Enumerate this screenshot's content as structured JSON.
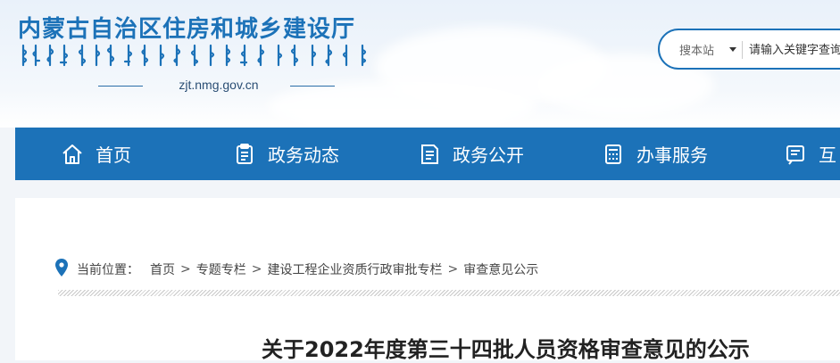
{
  "header": {
    "title": "内蒙古自治区住房和城乡建设厅",
    "domain": "zjt.nmg.gov.cn"
  },
  "search": {
    "scope": "搜本站",
    "placeholder": "请输入关键字查询"
  },
  "nav": {
    "items": [
      {
        "label": "首页",
        "icon": "home-icon"
      },
      {
        "label": "政务动态",
        "icon": "clipboard-icon"
      },
      {
        "label": "政务公开",
        "icon": "document-icon"
      },
      {
        "label": "办事服务",
        "icon": "calculator-icon"
      },
      {
        "label": "互",
        "icon": "interaction-icon"
      }
    ]
  },
  "breadcrumb": {
    "prefix": "当前位置：",
    "items": [
      "首页",
      "专题专栏",
      "建设工程企业资质行政审批专栏",
      "审查意见公示"
    ],
    "separator": ">"
  },
  "article": {
    "title": "关于2022年度第三十四批人员资格审查意见的公示"
  },
  "colors": {
    "brand": "#1c72b8",
    "nav_bg": "#1c72b8"
  }
}
